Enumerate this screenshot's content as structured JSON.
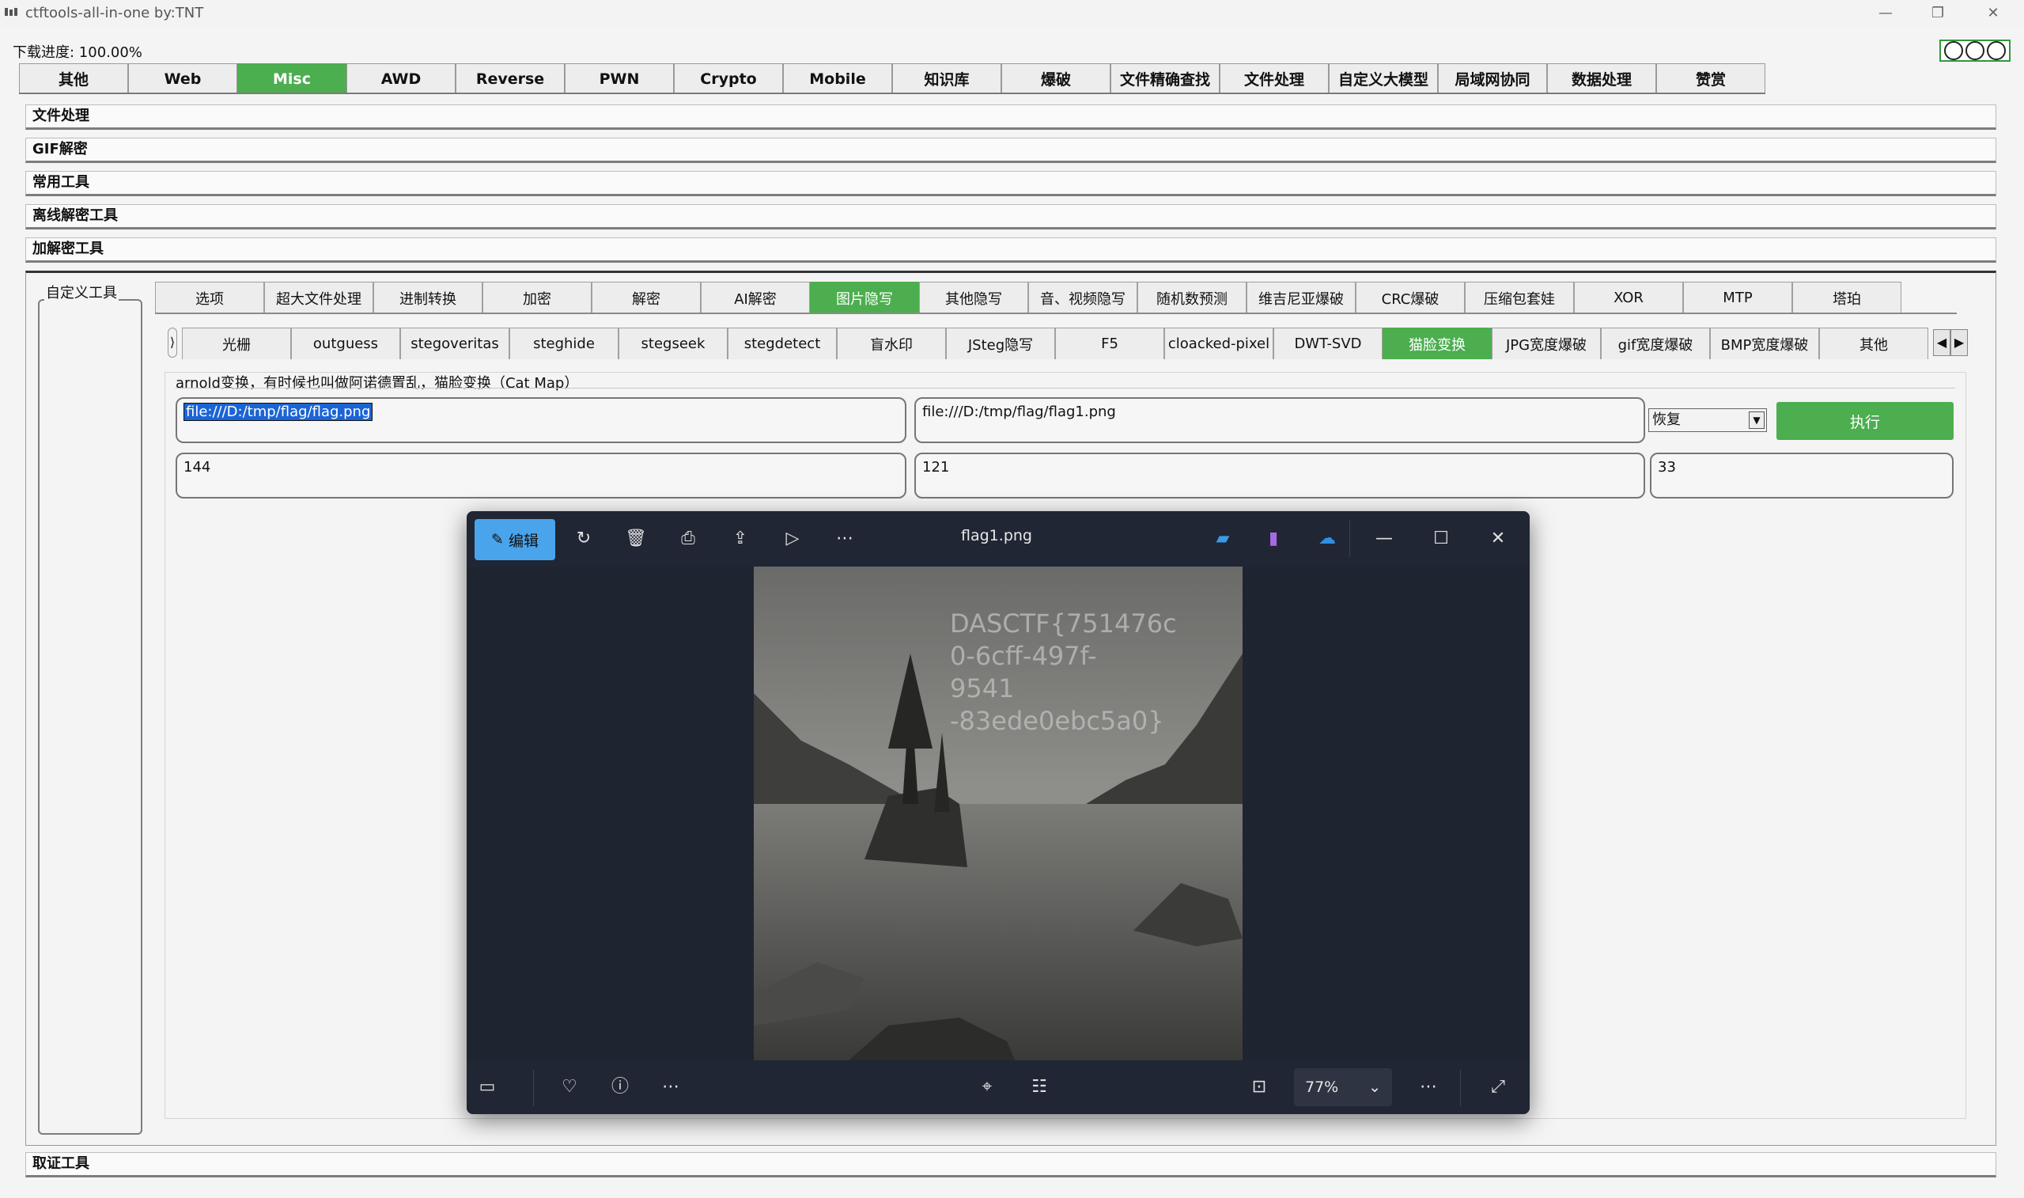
{
  "window": {
    "title": "ctftools-all-in-one   by:TNT",
    "minimize": "—",
    "restore": "❐",
    "close": "✕"
  },
  "progress": {
    "label": "下载进度: 100.00%"
  },
  "main_tabs": [
    "其他",
    "Web",
    "Misc",
    "AWD",
    "Reverse",
    "PWN",
    "Crypto",
    "Mobile",
    "知识库",
    "爆破",
    "文件精确查找",
    "文件处理",
    "自定义大模型",
    "局域网协同",
    "数据处理",
    "赞赏"
  ],
  "main_tab_active": "Misc",
  "sections": [
    "文件处理",
    "GIF解密",
    "常用工具",
    "离线解密工具",
    "加解密工具"
  ],
  "bottom_section": "取证工具",
  "custom_tools_label": "自定义工具",
  "sub_tabs": [
    "选项",
    "超大文件处理",
    "进制转换",
    "加密",
    "解密",
    "AI解密",
    "图片隐写",
    "其他隐写",
    "音、视频隐写",
    "随机数预测",
    "维吉尼亚爆破",
    "CRC爆破",
    "压缩包套娃",
    "XOR",
    "MTP",
    "塔珀"
  ],
  "sub_tab_active": "图片隐写",
  "subsub_tabs": [
    "光栅",
    "outguess",
    "stegoveritas",
    "steghide",
    "stegseek",
    "stegdetect",
    "盲水印",
    "JSteg隐写",
    "F5",
    "cloacked-pixel",
    "DWT-SVD",
    "猫脸变换",
    "JPG宽度爆破",
    "gif宽度爆破",
    "BMP宽度爆破",
    "其他"
  ],
  "subsub_tab_active": "猫脸变换",
  "description": "arnold变换，有时候也叫做阿诺德置乱，猫脸变换（Cat Map）",
  "inputs": {
    "input_path": "file:///D:/tmp/flag/flag.png",
    "output_path": "file:///D:/tmp/flag/flag1.png",
    "mode": "恢复",
    "param1": "144",
    "param2": "121",
    "param3": "33"
  },
  "execute_label": "执行",
  "viewer": {
    "edit_label": "编辑",
    "filename": "flag1.png",
    "zoom": "77%",
    "flag_lines": [
      "DASCTF{751476c",
      "0-6cff-497f-9541",
      "-83ede0ebc5a0}"
    ]
  },
  "colors": {
    "accent_green": "#4cae4f",
    "viewer_bg": "#1e2430",
    "selection_blue": "#1b64d6"
  }
}
